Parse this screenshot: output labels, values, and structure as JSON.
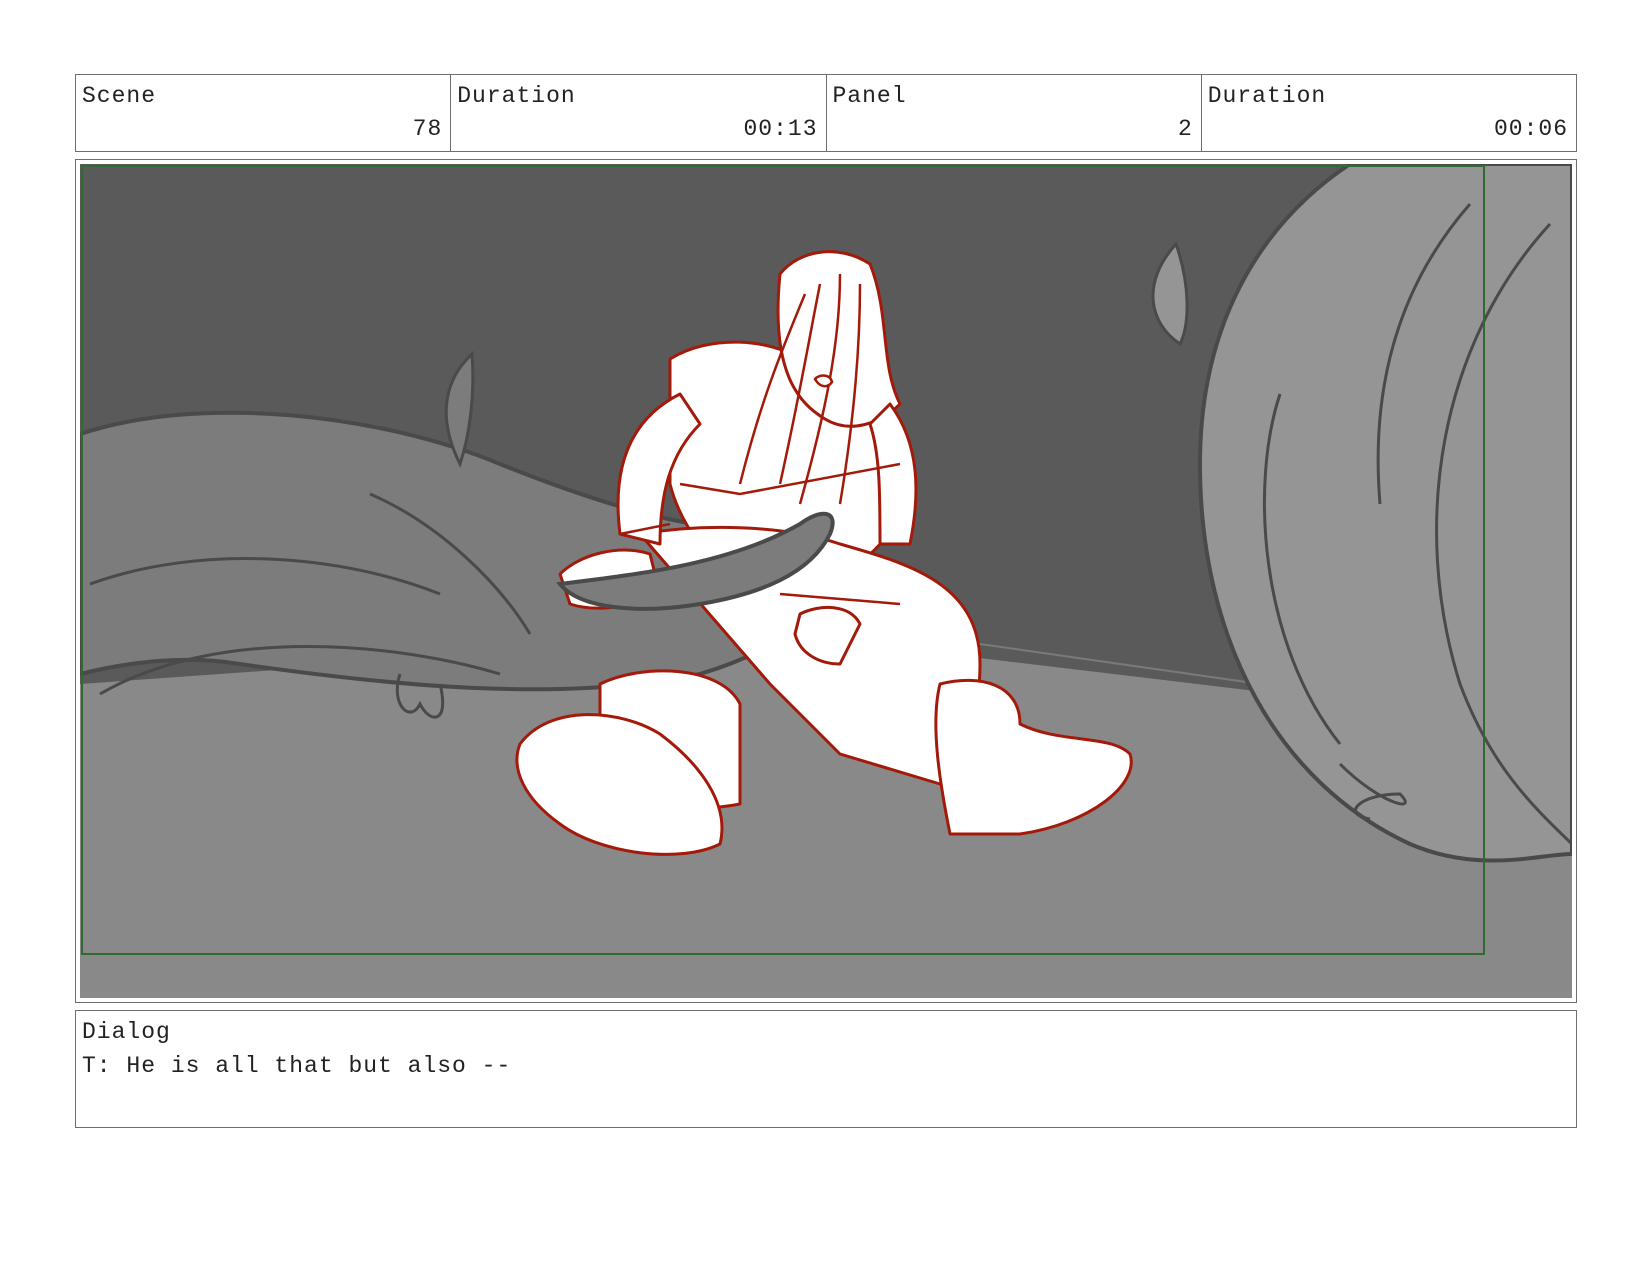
{
  "header": {
    "scene_label": "Scene",
    "scene_value": "78",
    "scene_duration_label": "Duration",
    "scene_duration_value": "00:13",
    "panel_label": "Panel",
    "panel_value": "2",
    "panel_duration_label": "Duration",
    "panel_duration_value": "00:06"
  },
  "dialog": {
    "label": "Dialog",
    "text": "T: He is all that but also --"
  },
  "colors": {
    "sketch_red": "#a31a0a",
    "safe_frame_green": "#2e6b2e",
    "background_dark": "#5a5a5a",
    "floor": "#898989"
  }
}
